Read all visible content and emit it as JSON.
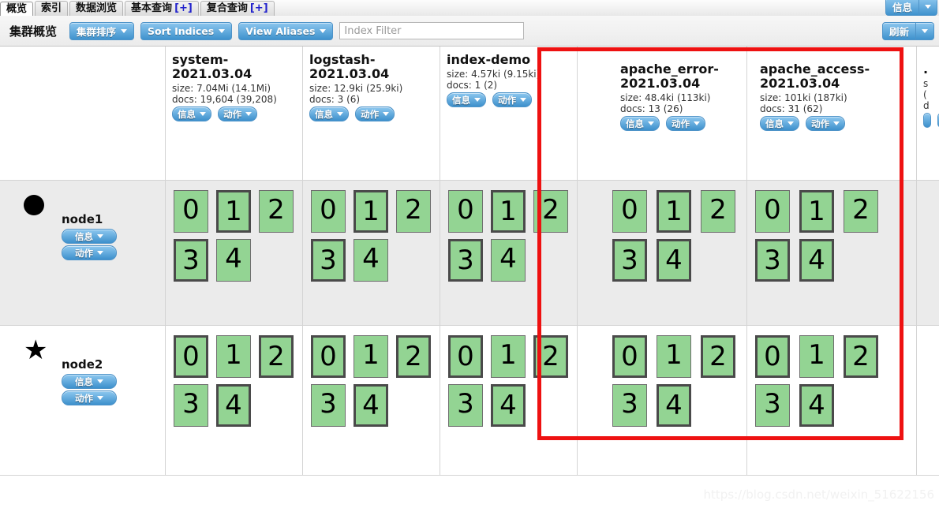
{
  "tabs": [
    {
      "label": "概览",
      "active": true,
      "plus": ""
    },
    {
      "label": "索引",
      "active": false,
      "plus": ""
    },
    {
      "label": "数据浏览",
      "active": false,
      "plus": ""
    },
    {
      "label": "基本查询",
      "active": false,
      "plus": "[+]"
    },
    {
      "label": "复合查询",
      "active": false,
      "plus": "[+]"
    }
  ],
  "topright": {
    "info_label": "信息"
  },
  "toolbar": {
    "title": "集群概览",
    "sort_cluster_label": "集群排序",
    "sort_indices_label": "Sort Indices",
    "view_aliases_label": "View Aliases",
    "refresh_label": "刷新"
  },
  "search": {
    "placeholder": "Index Filter",
    "value": ""
  },
  "labels": {
    "info": "信息",
    "action": "动作"
  },
  "indices": [
    {
      "name": "system-2021.03.04",
      "size": "size: 7.04Mi (14.1Mi)",
      "docs": "docs: 19,604 (39,208)",
      "shard_count": 5,
      "stacked_buttons": true
    },
    {
      "name": "logstash-2021.03.04",
      "size": "size: 12.9ki (25.9ki)",
      "docs": "docs: 3 (6)",
      "shard_count": 5,
      "stacked_buttons": true
    },
    {
      "name": "index-demo",
      "size": "size: 4.57ki (9.15ki)",
      "docs": "docs: 1 (2)",
      "shard_count": 5,
      "stacked_buttons": true
    },
    {
      "name": "apache_error-2021.03.04",
      "size": "size: 48.4ki (113ki)",
      "docs": "docs: 13 (26)",
      "shard_count": 5,
      "stacked_buttons": false
    },
    {
      "name": "apache_access-2021.03.04",
      "size": "size: 101ki (187ki)",
      "docs": "docs: 31 (62)",
      "shard_count": 5,
      "stacked_buttons": false
    }
  ],
  "nodes": [
    {
      "name": "node1",
      "marker": "circle-icon",
      "shard_rows": [
        {
          "index": "system-2021.03.04",
          "shards": [
            {
              "id": "0",
              "type": "replica"
            },
            {
              "id": "1",
              "type": "primary"
            },
            {
              "id": "2",
              "type": "replica"
            },
            {
              "id": "3",
              "type": "primary"
            },
            {
              "id": "4",
              "type": "replica"
            }
          ]
        },
        {
          "index": "logstash-2021.03.04",
          "shards": [
            {
              "id": "0",
              "type": "replica"
            },
            {
              "id": "1",
              "type": "primary"
            },
            {
              "id": "2",
              "type": "replica"
            },
            {
              "id": "3",
              "type": "primary"
            },
            {
              "id": "4",
              "type": "replica"
            }
          ]
        },
        {
          "index": "index-demo",
          "shards": [
            {
              "id": "0",
              "type": "replica"
            },
            {
              "id": "1",
              "type": "primary"
            },
            {
              "id": "2",
              "type": "replica"
            },
            {
              "id": "3",
              "type": "primary"
            },
            {
              "id": "4",
              "type": "replica"
            }
          ]
        },
        {
          "index": "apache_error-2021.03.04",
          "shards": [
            {
              "id": "0",
              "type": "replica"
            },
            {
              "id": "1",
              "type": "primary"
            },
            {
              "id": "2",
              "type": "replica"
            },
            {
              "id": "3",
              "type": "primary"
            },
            {
              "id": "4",
              "type": "primary"
            }
          ]
        },
        {
          "index": "apache_access-2021.03.04",
          "shards": [
            {
              "id": "0",
              "type": "replica"
            },
            {
              "id": "1",
              "type": "primary"
            },
            {
              "id": "2",
              "type": "replica"
            },
            {
              "id": "3",
              "type": "primary"
            },
            {
              "id": "4",
              "type": "primary"
            }
          ]
        }
      ]
    },
    {
      "name": "node2",
      "marker": "star-icon",
      "shard_rows": [
        {
          "index": "system-2021.03.04",
          "shards": [
            {
              "id": "0",
              "type": "primary"
            },
            {
              "id": "1",
              "type": "replica"
            },
            {
              "id": "2",
              "type": "primary"
            },
            {
              "id": "3",
              "type": "replica"
            },
            {
              "id": "4",
              "type": "primary"
            }
          ]
        },
        {
          "index": "logstash-2021.03.04",
          "shards": [
            {
              "id": "0",
              "type": "primary"
            },
            {
              "id": "1",
              "type": "replica"
            },
            {
              "id": "2",
              "type": "primary"
            },
            {
              "id": "3",
              "type": "replica"
            },
            {
              "id": "4",
              "type": "primary"
            }
          ]
        },
        {
          "index": "index-demo",
          "shards": [
            {
              "id": "0",
              "type": "primary"
            },
            {
              "id": "1",
              "type": "replica"
            },
            {
              "id": "2",
              "type": "primary"
            },
            {
              "id": "3",
              "type": "replica"
            },
            {
              "id": "4",
              "type": "primary"
            }
          ]
        },
        {
          "index": "apache_error-2021.03.04",
          "shards": [
            {
              "id": "0",
              "type": "primary"
            },
            {
              "id": "1",
              "type": "replica"
            },
            {
              "id": "2",
              "type": "primary"
            },
            {
              "id": "3",
              "type": "replica"
            },
            {
              "id": "4",
              "type": "primary"
            }
          ]
        },
        {
          "index": "apache_access-2021.03.04",
          "shards": [
            {
              "id": "0",
              "type": "primary"
            },
            {
              "id": "1",
              "type": "replica"
            },
            {
              "id": "2",
              "type": "primary"
            },
            {
              "id": "3",
              "type": "replica"
            },
            {
              "id": "4",
              "type": "primary"
            }
          ]
        }
      ]
    }
  ],
  "annotation": {
    "color": "#ee1111",
    "covers": [
      "apache_error-2021.03.04",
      "apache_access-2021.03.04"
    ]
  },
  "watermark": "https://blog.csdn.net/weixin_51622156",
  "colors": {
    "shard_fill": "#93d493",
    "shard_border": "#4a4a4a",
    "button_blue": "#3f92cd",
    "annotation_red": "#ee1111",
    "row_alt_bg": "#ebebeb"
  }
}
